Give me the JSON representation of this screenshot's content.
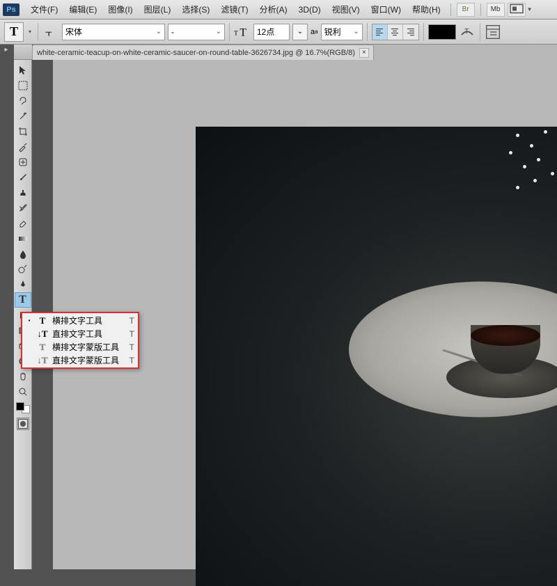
{
  "menubar": {
    "items": [
      "文件(F)",
      "编辑(E)",
      "图像(I)",
      "图层(L)",
      "选择(S)",
      "滤镜(T)",
      "分析(A)",
      "3D(D)",
      "视图(V)",
      "窗口(W)",
      "帮助(H)"
    ],
    "logo": "Ps",
    "right_buttons": [
      "Br",
      "Mb"
    ]
  },
  "optbar": {
    "tool_glyph": "T",
    "font_family": "宋体",
    "font_style": "-",
    "font_size": "12点",
    "aa_mode": "锐利"
  },
  "filetab": {
    "label": "white-ceramic-teacup-on-white-ceramic-saucer-on-round-table-3626734.jpg @ 16.7%(RGB/8)"
  },
  "tool_popup": {
    "items": [
      {
        "dot": "▪",
        "icon": "T",
        "label": "横排文字工具",
        "key": "T",
        "dotted": false
      },
      {
        "dot": "",
        "icon": "↓T",
        "label": "直排文字工具",
        "key": "T",
        "dotted": false
      },
      {
        "dot": "",
        "icon": "T",
        "label": "横排文字蒙版工具",
        "key": "T",
        "dotted": true
      },
      {
        "dot": "",
        "icon": "↓T",
        "label": "直排文字蒙版工具",
        "key": "T",
        "dotted": true
      }
    ]
  }
}
